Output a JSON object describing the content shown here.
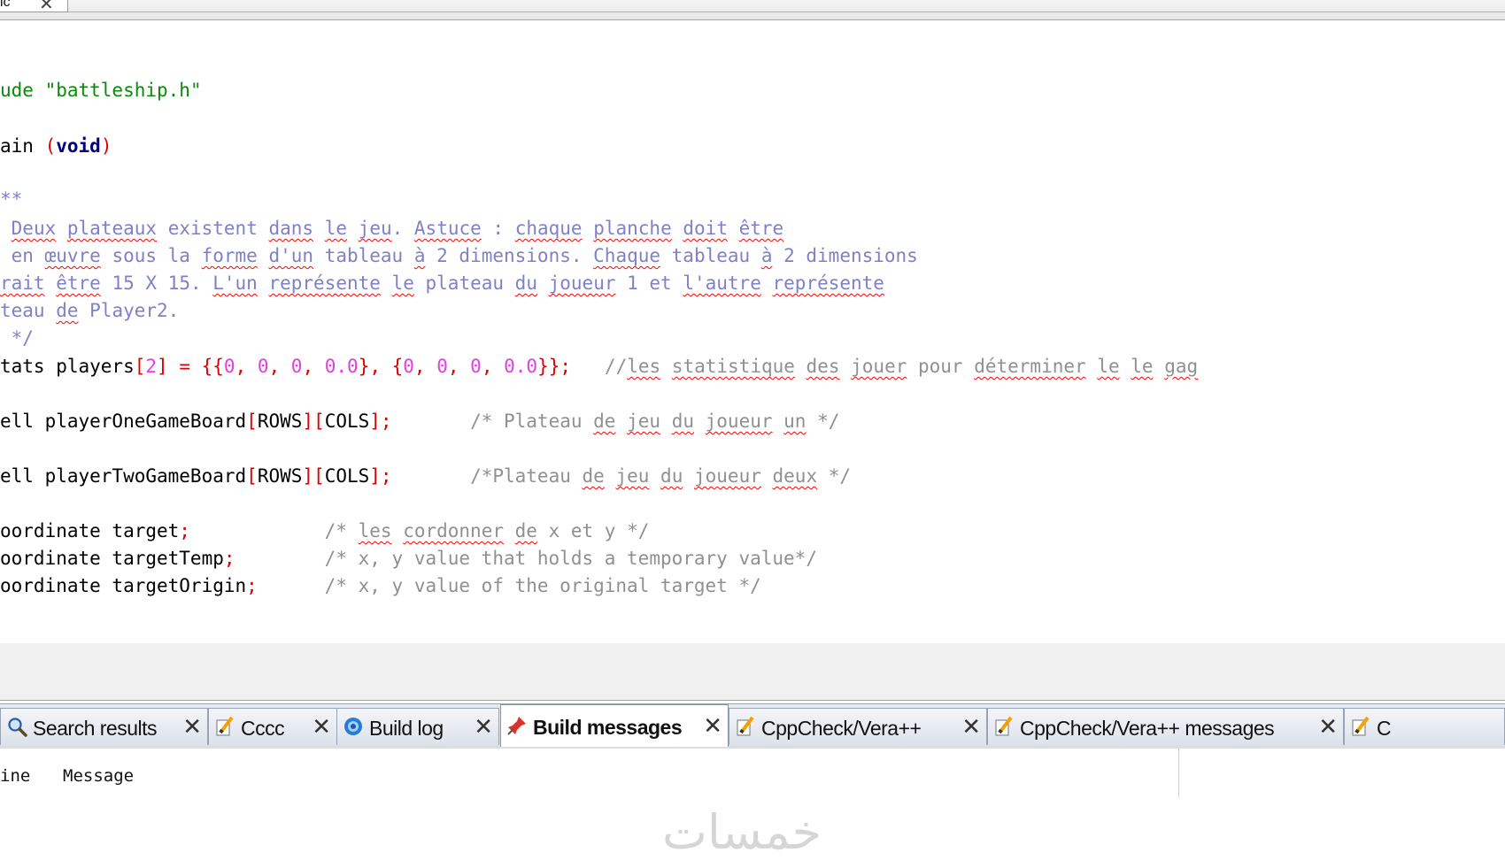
{
  "editor_tab": {
    "label": "ic",
    "close": "✕"
  },
  "code_lines": [
    [
      {
        "c": "pre",
        "t": "ude "
      },
      {
        "c": "s",
        "t": "\"battleship.h\""
      }
    ],
    [
      {
        "c": "t",
        "t": "ain "
      },
      {
        "c": "p",
        "t": "("
      },
      {
        "c": "k",
        "t": "void"
      },
      {
        "c": "p",
        "t": ")"
      }
    ],
    [
      {
        "c": "cm",
        "t": "**"
      }
    ],
    [
      {
        "c": "cm",
        "t": " "
      },
      {
        "c": "cm spell",
        "t": "Deux"
      },
      {
        "c": "cm",
        "t": " "
      },
      {
        "c": "cm spell",
        "t": "plateaux"
      },
      {
        "c": "cm",
        "t": " existent "
      },
      {
        "c": "cm spell",
        "t": "dans"
      },
      {
        "c": "cm",
        "t": " "
      },
      {
        "c": "cm spell",
        "t": "le"
      },
      {
        "c": "cm",
        "t": " "
      },
      {
        "c": "cm spell",
        "t": "jeu"
      },
      {
        "c": "cm",
        "t": ". "
      },
      {
        "c": "cm spell",
        "t": "Astuce"
      },
      {
        "c": "cm",
        "t": " : "
      },
      {
        "c": "cm spell",
        "t": "chaque"
      },
      {
        "c": "cm",
        "t": " "
      },
      {
        "c": "cm spell",
        "t": "planche"
      },
      {
        "c": "cm",
        "t": " "
      },
      {
        "c": "cm spell",
        "t": "doit"
      },
      {
        "c": "cm",
        "t": " "
      },
      {
        "c": "cm spell",
        "t": "être"
      }
    ],
    [
      {
        "c": "cm",
        "t": " en "
      },
      {
        "c": "cm spell",
        "t": "œuvre"
      },
      {
        "c": "cm",
        "t": " sous la "
      },
      {
        "c": "cm spell",
        "t": "forme"
      },
      {
        "c": "cm",
        "t": " "
      },
      {
        "c": "cm spell",
        "t": "d'un"
      },
      {
        "c": "cm",
        "t": " tableau "
      },
      {
        "c": "cm spell",
        "t": "à"
      },
      {
        "c": "cm",
        "t": " 2 dimensions. "
      },
      {
        "c": "cm spell",
        "t": "Chaque"
      },
      {
        "c": "cm",
        "t": " tableau "
      },
      {
        "c": "cm spell",
        "t": "à"
      },
      {
        "c": "cm",
        "t": " 2 dimensions"
      }
    ],
    [
      {
        "c": "cm spell",
        "t": "rait"
      },
      {
        "c": "cm",
        "t": " "
      },
      {
        "c": "cm spell",
        "t": "être"
      },
      {
        "c": "cm",
        "t": " 15 X 15. "
      },
      {
        "c": "cm spell",
        "t": "L'un"
      },
      {
        "c": "cm",
        "t": " "
      },
      {
        "c": "cm spell",
        "t": "représente"
      },
      {
        "c": "cm",
        "t": " "
      },
      {
        "c": "cm spell",
        "t": "le"
      },
      {
        "c": "cm",
        "t": " plateau "
      },
      {
        "c": "cm spell",
        "t": "du"
      },
      {
        "c": "cm",
        "t": " "
      },
      {
        "c": "cm spell",
        "t": "joueur"
      },
      {
        "c": "cm",
        "t": " 1 et "
      },
      {
        "c": "cm spell",
        "t": "l'autre"
      },
      {
        "c": "cm",
        "t": " "
      },
      {
        "c": "cm spell",
        "t": "représente"
      }
    ],
    [
      {
        "c": "cm",
        "t": "teau "
      },
      {
        "c": "cm spell",
        "t": "de"
      },
      {
        "c": "cm",
        "t": " Player2."
      }
    ],
    [
      {
        "c": "cm",
        "t": " */"
      }
    ],
    [
      {
        "c": "t",
        "t": "tats players"
      },
      {
        "c": "p",
        "t": "["
      },
      {
        "c": "n",
        "t": "2"
      },
      {
        "c": "p",
        "t": "] = {{"
      },
      {
        "c": "n",
        "t": "0"
      },
      {
        "c": "p",
        "t": ", "
      },
      {
        "c": "n",
        "t": "0"
      },
      {
        "c": "p",
        "t": ", "
      },
      {
        "c": "n",
        "t": "0"
      },
      {
        "c": "p",
        "t": ", "
      },
      {
        "c": "n",
        "t": "0.0"
      },
      {
        "c": "p",
        "t": "}, {"
      },
      {
        "c": "n",
        "t": "0"
      },
      {
        "c": "p",
        "t": ", "
      },
      {
        "c": "n",
        "t": "0"
      },
      {
        "c": "p",
        "t": ", "
      },
      {
        "c": "n",
        "t": "0"
      },
      {
        "c": "p",
        "t": ", "
      },
      {
        "c": "n",
        "t": "0.0"
      },
      {
        "c": "p",
        "t": "}};"
      },
      {
        "c": "cmg",
        "t": "   //"
      },
      {
        "c": "cmg spell",
        "t": "les"
      },
      {
        "c": "cmg",
        "t": " "
      },
      {
        "c": "cmg spell",
        "t": "statistique"
      },
      {
        "c": "cmg",
        "t": " "
      },
      {
        "c": "cmg spell",
        "t": "des"
      },
      {
        "c": "cmg",
        "t": " "
      },
      {
        "c": "cmg spell",
        "t": "jouer"
      },
      {
        "c": "cmg",
        "t": " pour "
      },
      {
        "c": "cmg spell",
        "t": "déterminer"
      },
      {
        "c": "cmg",
        "t": " "
      },
      {
        "c": "cmg spell",
        "t": "le"
      },
      {
        "c": "cmg",
        "t": " "
      },
      {
        "c": "cmg spell",
        "t": "le"
      },
      {
        "c": "cmg",
        "t": " "
      },
      {
        "c": "cmg spell",
        "t": "gag"
      }
    ],
    [
      {
        "c": "t",
        "t": "ell playerOneGameBoard"
      },
      {
        "c": "p",
        "t": "["
      },
      {
        "c": "t",
        "t": "ROWS"
      },
      {
        "c": "p",
        "t": "]["
      },
      {
        "c": "t",
        "t": "COLS"
      },
      {
        "c": "p",
        "t": "];"
      },
      {
        "c": "cmg",
        "t": "       /* Plateau "
      },
      {
        "c": "cmg spell",
        "t": "de"
      },
      {
        "c": "cmg",
        "t": " "
      },
      {
        "c": "cmg spell",
        "t": "jeu"
      },
      {
        "c": "cmg",
        "t": " "
      },
      {
        "c": "cmg spell",
        "t": "du"
      },
      {
        "c": "cmg",
        "t": " "
      },
      {
        "c": "cmg spell",
        "t": "joueur"
      },
      {
        "c": "cmg",
        "t": " "
      },
      {
        "c": "cmg spell",
        "t": "un"
      },
      {
        "c": "cmg",
        "t": " */"
      }
    ],
    [
      {
        "c": "t",
        "t": "ell playerTwoGameBoard"
      },
      {
        "c": "p",
        "t": "["
      },
      {
        "c": "t",
        "t": "ROWS"
      },
      {
        "c": "p",
        "t": "]["
      },
      {
        "c": "t",
        "t": "COLS"
      },
      {
        "c": "p",
        "t": "];"
      },
      {
        "c": "cmg",
        "t": "       /*Plateau "
      },
      {
        "c": "cmg spell",
        "t": "de"
      },
      {
        "c": "cmg",
        "t": " "
      },
      {
        "c": "cmg spell",
        "t": "jeu"
      },
      {
        "c": "cmg",
        "t": " "
      },
      {
        "c": "cmg spell",
        "t": "du"
      },
      {
        "c": "cmg",
        "t": " "
      },
      {
        "c": "cmg spell",
        "t": "joueur"
      },
      {
        "c": "cmg",
        "t": " "
      },
      {
        "c": "cmg spell",
        "t": "deux"
      },
      {
        "c": "cmg",
        "t": " */"
      }
    ],
    [
      {
        "c": "t",
        "t": "oordinate target"
      },
      {
        "c": "p",
        "t": ";"
      },
      {
        "c": "cmg",
        "t": "            /* "
      },
      {
        "c": "cmg spell",
        "t": "les"
      },
      {
        "c": "cmg",
        "t": " "
      },
      {
        "c": "cmg spell",
        "t": "cordonner"
      },
      {
        "c": "cmg",
        "t": " "
      },
      {
        "c": "cmg spell",
        "t": "de"
      },
      {
        "c": "cmg",
        "t": " x et y */"
      }
    ],
    [
      {
        "c": "t",
        "t": "oordinate targetTemp"
      },
      {
        "c": "p",
        "t": ";"
      },
      {
        "c": "cmg",
        "t": "        /* x, y value that holds a temporary value*/"
      }
    ],
    [
      {
        "c": "t",
        "t": "oordinate targetOrigin"
      },
      {
        "c": "p",
        "t": ";"
      },
      {
        "c": "cmg",
        "t": "      /* x, y value of the original target */"
      }
    ]
  ],
  "log_tabs": [
    {
      "label": "Search results",
      "icon": "search-icon",
      "close": "✕",
      "active": false
    },
    {
      "label": "Cccc",
      "icon": "pencil-note-icon",
      "close": "✕",
      "active": false
    },
    {
      "label": "Build log",
      "icon": "gear-build-icon",
      "close": "✕",
      "active": false
    },
    {
      "label": "Build messages",
      "icon": "pin-icon",
      "close": "✕",
      "active": true
    },
    {
      "label": "CppCheck/Vera++",
      "icon": "pencil-note-icon",
      "close": "✕",
      "active": false
    },
    {
      "label": "CppCheck/Vera++ messages",
      "icon": "pencil-note-icon",
      "close": "✕",
      "active": false
    },
    {
      "label": "C",
      "icon": "pencil-note-icon",
      "close": "",
      "active": false
    }
  ],
  "messages": {
    "col_line": "ine",
    "col_message": "Message"
  },
  "watermark": "خمسات",
  "colors": {
    "keyword": "#000080",
    "punct": "#e00000",
    "number": "#e040e0",
    "string": "#0a8a0a",
    "doc_comment": "#8080c8",
    "comment": "#909090"
  }
}
